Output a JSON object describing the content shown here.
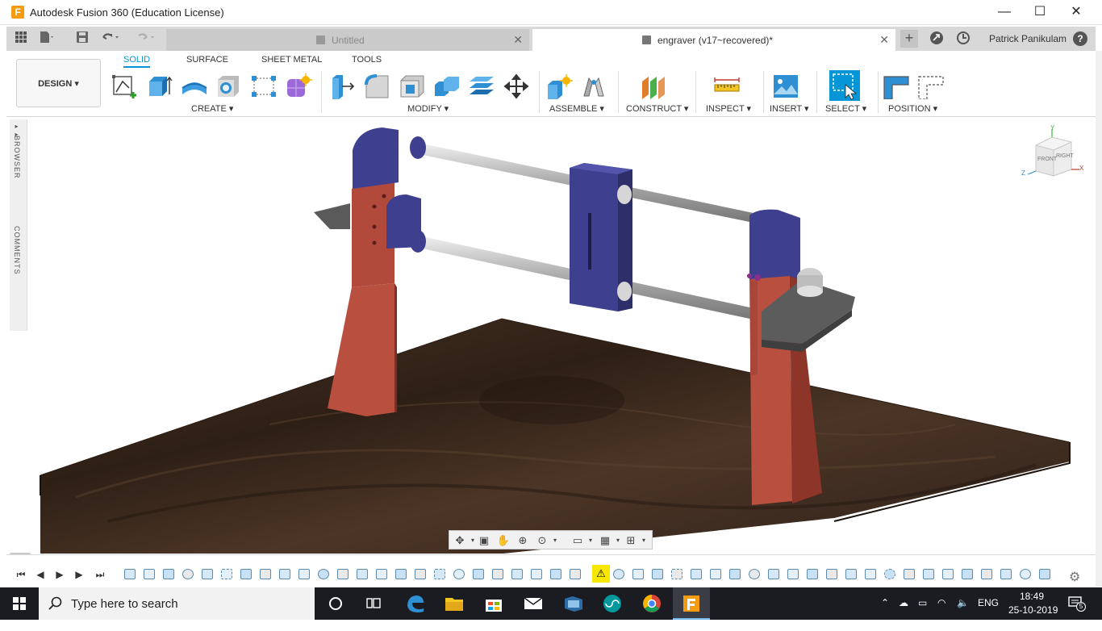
{
  "window": {
    "title": "Autodesk Fusion 360 (Education License)",
    "logo_letter": "F",
    "minimize": "—",
    "maximize": "☐",
    "close": "✕"
  },
  "tabs": {
    "untitled": "Untitled",
    "engraver": "engraver (v17~recovered)*",
    "close_glyph": "✕",
    "new_tab": "+",
    "user": "Patrick Panikulam",
    "help": "?"
  },
  "toolbar": {
    "design": "DESIGN ▾",
    "workspace_tabs": [
      "SOLID",
      "SURFACE",
      "SHEET METAL",
      "TOOLS"
    ],
    "groups": {
      "create": "CREATE ▾",
      "modify": "MODIFY ▾",
      "assemble": "ASSEMBLE ▾",
      "construct": "CONSTRUCT ▾",
      "inspect": "INSPECT ▾",
      "insert": "INSERT ▾",
      "select": "SELECT ▾",
      "position": "POSITION ▾"
    }
  },
  "browser": {
    "browser_label": "BROWSER",
    "comments_label": "COMMENTS",
    "expand_glyph": "▸▸"
  },
  "viewcube": {
    "front": "FRONT",
    "right": "RIGHT",
    "y": "Y",
    "z": "Z",
    "x": "X"
  },
  "timeline": {
    "first": "⏮",
    "prev": "◀",
    "play": "▶",
    "next": "▶",
    "last": "⏭",
    "warning": "⚠",
    "settings": "⚙"
  },
  "taskbar": {
    "search_placeholder": "Type here to search",
    "language": "ENG",
    "time": "18:49",
    "date": "25-10-2019",
    "notification_count": "5"
  },
  "colors": {
    "accent": "#0696d7",
    "bracket_red": "#b5473a",
    "carriage_blue": "#3e3f8e",
    "wood_dark": "#3b2a1f"
  }
}
